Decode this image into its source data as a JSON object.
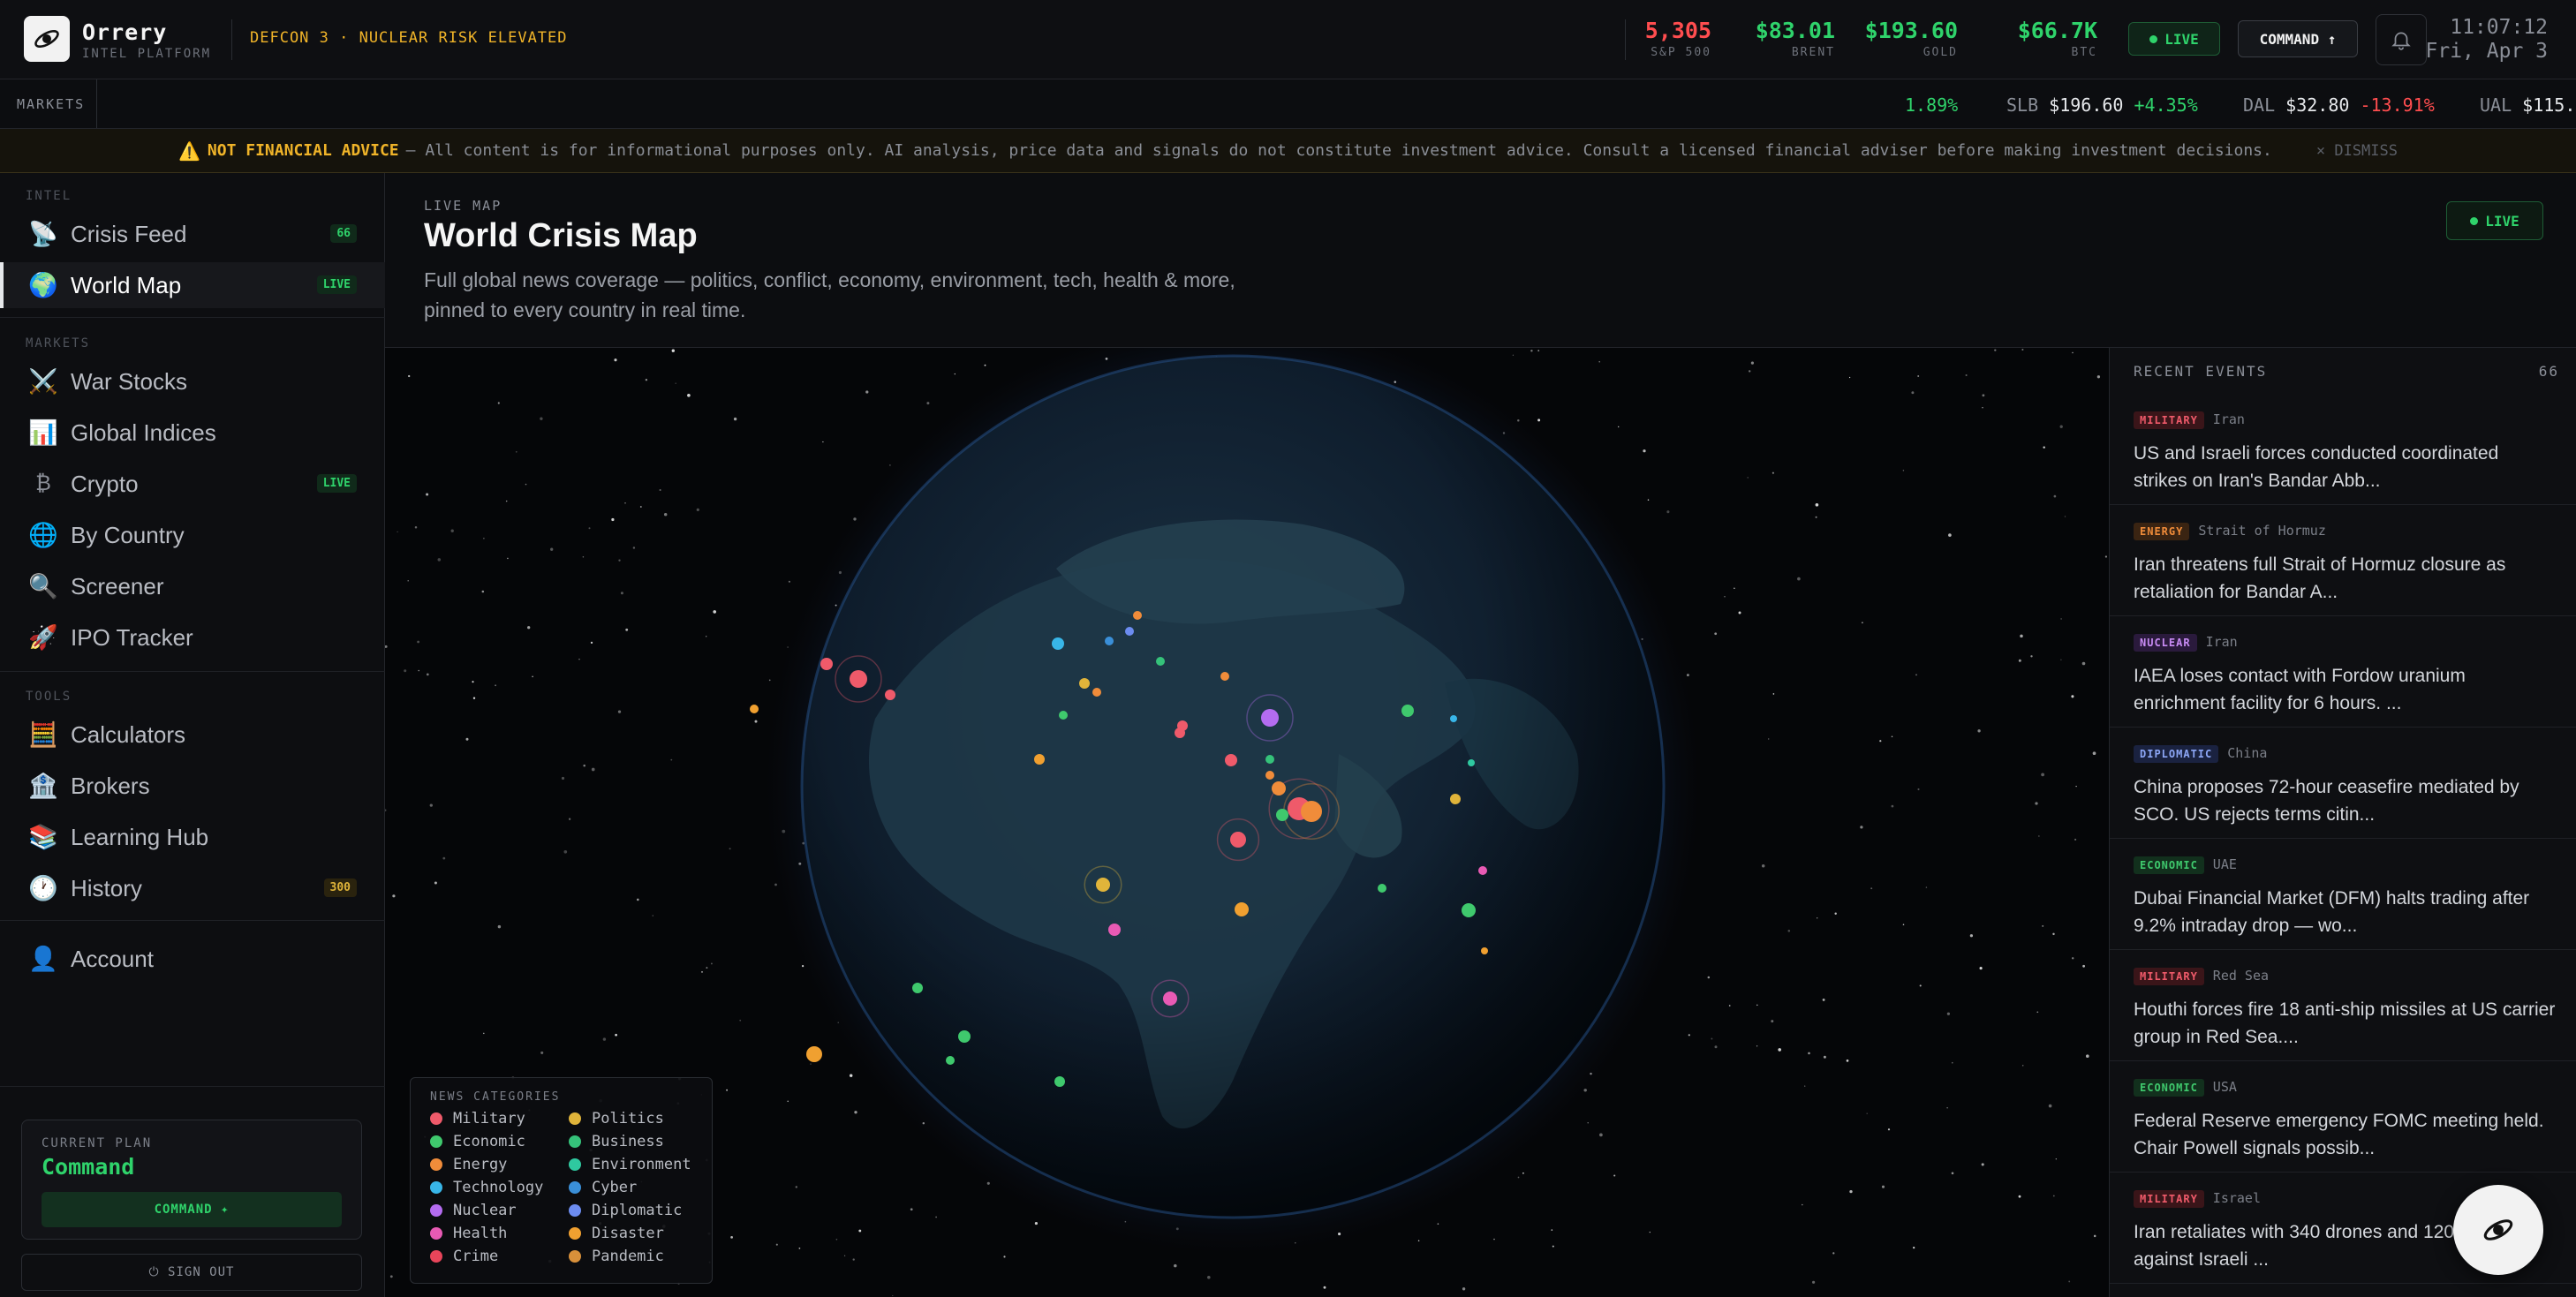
{
  "brand": {
    "name": "Orrery",
    "subtitle": "INTEL PLATFORM"
  },
  "alert": "DEFCON 3 · NUCLEAR RISK ELEVATED",
  "tickers": [
    {
      "value": "5,305",
      "label": "S&P 500",
      "color": "#ff4d4f"
    },
    {
      "value": "$83.01",
      "label": "BRENT",
      "color": "#2fd36b"
    },
    {
      "value": "$193.60",
      "label": "GOLD",
      "color": "#2fd36b"
    },
    {
      "value": "$66.7K",
      "label": "BTC",
      "color": "#2fd36b"
    }
  ],
  "live_label": "LIVE",
  "command_label": "COMMAND ↑",
  "clock": {
    "time": "11:07:12",
    "date": "Fri, Apr 3"
  },
  "market_strip": {
    "label": "MARKETS",
    "items": [
      {
        "symbol": "",
        "price": "",
        "change": "1.89%",
        "dir": "up"
      },
      {
        "symbol": "SLB",
        "price": "$196.60",
        "change": "+4.35%",
        "dir": "up"
      },
      {
        "symbol": "DAL",
        "price": "$32.80",
        "change": "-13.91%",
        "dir": "down"
      },
      {
        "symbol": "UAL",
        "price": "$115.",
        "change": "",
        "dir": "up"
      }
    ]
  },
  "disclaimer": {
    "title": "NOT FINANCIAL ADVICE",
    "text": "— All content is for informational purposes only. AI analysis, price data and signals do not constitute investment advice. Consult a licensed financial adviser before making investment decisions.",
    "dismiss": "× DISMISS"
  },
  "sidebar": {
    "sections": {
      "intel": "INTEL",
      "markets": "MARKETS",
      "tools": "TOOLS"
    },
    "intel": [
      {
        "label": "Crisis Feed",
        "icon": "satellite-icon",
        "badge": "66"
      },
      {
        "label": "World Map",
        "icon": "globe-icon",
        "badge": "LIVE"
      }
    ],
    "markets": [
      {
        "label": "War Stocks",
        "icon": "crossed-swords-icon",
        "badge": ""
      },
      {
        "label": "Global Indices",
        "icon": "bar-chart-icon",
        "badge": ""
      },
      {
        "label": "Crypto",
        "icon": "bitcoin-icon",
        "badge": "LIVE"
      },
      {
        "label": "By Country",
        "icon": "globe-meridians-icon",
        "badge": ""
      },
      {
        "label": "Screener",
        "icon": "magnifier-icon",
        "badge": ""
      },
      {
        "label": "IPO Tracker",
        "icon": "rocket-icon",
        "badge": ""
      }
    ],
    "tools": [
      {
        "label": "Calculators",
        "icon": "abacus-icon",
        "badge": ""
      },
      {
        "label": "Brokers",
        "icon": "bank-icon",
        "badge": ""
      },
      {
        "label": "Learning Hub",
        "icon": "books-icon",
        "badge": ""
      },
      {
        "label": "History",
        "icon": "clock-icon",
        "badge": "300"
      }
    ],
    "account": {
      "label": "Account",
      "icon": "user-icon"
    },
    "plan": {
      "label": "CURRENT PLAN",
      "name": "Command",
      "button": "COMMAND ✦"
    },
    "signout": "⏻ SIGN OUT"
  },
  "page": {
    "kicker": "LIVE MAP",
    "title": "World Crisis Map",
    "description": "Full global news coverage — politics, conflict, economy, environment, tech, health & more, pinned to every country in real time.",
    "live": "LIVE"
  },
  "legend": {
    "title": "NEWS CATEGORIES",
    "items": [
      {
        "label": "Military",
        "color": "#ef5a6a"
      },
      {
        "label": "Politics",
        "color": "#e0b43a"
      },
      {
        "label": "Economic",
        "color": "#3fc96d"
      },
      {
        "label": "Business",
        "color": "#35c27a"
      },
      {
        "label": "Energy",
        "color": "#f08c3a"
      },
      {
        "label": "Environment",
        "color": "#2fc9a0"
      },
      {
        "label": "Technology",
        "color": "#38b6e8"
      },
      {
        "label": "Cyber",
        "color": "#3a8fd8"
      },
      {
        "label": "Nuclear",
        "color": "#b46cf0"
      },
      {
        "label": "Diplomatic",
        "color": "#6c8cf0"
      },
      {
        "label": "Health",
        "color": "#e85ab4"
      },
      {
        "label": "Disaster",
        "color": "#f0a030"
      },
      {
        "label": "Crime",
        "color": "#e8455a"
      },
      {
        "label": "Pandemic",
        "color": "#d8903a"
      }
    ]
  },
  "events": {
    "title": "RECENT EVENTS",
    "count": "66",
    "items": [
      {
        "tag": "MILITARY",
        "tag_color": "#ef5a6a",
        "tag_bg": "#3a1519",
        "location": "Iran",
        "title": "US and Israeli forces conducted coordinated strikes on Iran's Bandar Abb..."
      },
      {
        "tag": "ENERGY",
        "tag_color": "#f08c3a",
        "tag_bg": "#3a2412",
        "location": "Strait of Hormuz",
        "title": "Iran threatens full Strait of Hormuz closure as retaliation for Bandar A..."
      },
      {
        "tag": "NUCLEAR",
        "tag_color": "#c98cf5",
        "tag_bg": "#2a1a3c",
        "location": "Iran",
        "title": "IAEA loses contact with Fordow uranium enrichment facility for 6 hours. ..."
      },
      {
        "tag": "DIPLOMATIC",
        "tag_color": "#8ca6f5",
        "tag_bg": "#1a2240",
        "location": "China",
        "title": "China proposes 72-hour ceasefire mediated by SCO. US rejects terms citin..."
      },
      {
        "tag": "ECONOMIC",
        "tag_color": "#3fc96d",
        "tag_bg": "#12301d",
        "location": "UAE",
        "title": "Dubai Financial Market (DFM) halts trading after 9.2% intraday drop — wo..."
      },
      {
        "tag": "MILITARY",
        "tag_color": "#ef5a6a",
        "tag_bg": "#3a1519",
        "location": "Red Sea",
        "title": "Houthi forces fire 18 anti-ship missiles at US carrier group in Red Sea...."
      },
      {
        "tag": "ECONOMIC",
        "tag_color": "#3fc96d",
        "tag_bg": "#12301d",
        "location": "USA",
        "title": "Federal Reserve emergency FOMC meeting held. Chair Powell signals possib..."
      },
      {
        "tag": "MILITARY",
        "tag_color": "#ef5a6a",
        "tag_bg": "#3a1519",
        "location": "Israel",
        "title": "Iran retaliates with 340 drones and 120 missiles against Israeli ..."
      }
    ]
  }
}
